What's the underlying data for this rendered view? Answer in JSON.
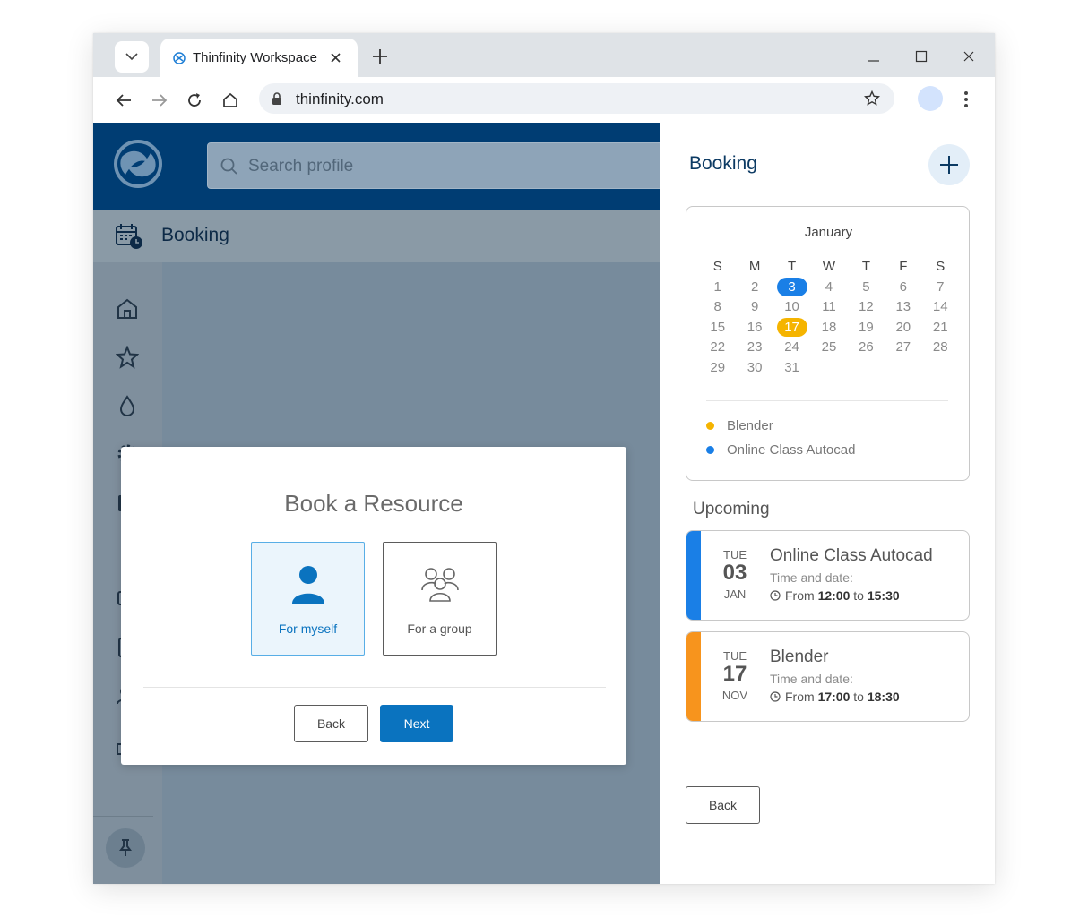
{
  "browser": {
    "tab_title": "Thinfinity Workspace",
    "url": "thinfinity.com"
  },
  "app": {
    "search_placeholder": "Search profile",
    "section_title": "Booking",
    "sidebar_icons": [
      "home-icon",
      "star-icon",
      "drop-icon",
      "gear-icon",
      "calendar-icon",
      "device-icon",
      "monitor-icon",
      "window-icon",
      "users-icon",
      "bar-chart-icon",
      "pin-icon"
    ]
  },
  "dialog": {
    "title": "Book a Resource",
    "option_myself": "For myself",
    "option_group": "For a group",
    "back_label": "Back",
    "next_label": "Next",
    "selected_option": "For myself"
  },
  "panel": {
    "title": "Booking",
    "calendar": {
      "month": "January",
      "weekdays": [
        "S",
        "M",
        "T",
        "W",
        "T",
        "F",
        "S"
      ],
      "weeks": [
        [
          "1",
          "2",
          "3",
          "4",
          "5",
          "6",
          "7"
        ],
        [
          "8",
          "9",
          "10",
          "11",
          "12",
          "13",
          "14"
        ],
        [
          "15",
          "16",
          "17",
          "18",
          "19",
          "20",
          "21"
        ],
        [
          "22",
          "23",
          "24",
          "25",
          "26",
          "27",
          "28"
        ],
        [
          "29",
          "30",
          "31",
          "",
          "",
          "",
          ""
        ]
      ],
      "highlights": {
        "3": "#1a7fe6",
        "17": "#f5b400"
      }
    },
    "legend": [
      {
        "label": "Blender",
        "color": "#f5b400"
      },
      {
        "label": "Online Class Autocad",
        "color": "#1a7fe6"
      }
    ],
    "upcoming_title": "Upcoming",
    "events": [
      {
        "dow": "TUE",
        "day": "03",
        "month": "JAN",
        "title": "Online Class Autocad",
        "subtitle": "Time and date:",
        "from_word": "From",
        "start": "12:00",
        "to_word": "to",
        "end": "15:30",
        "color": "#1a7fe6"
      },
      {
        "dow": "TUE",
        "day": "17",
        "month": "NOV",
        "title": "Blender",
        "subtitle": "Time and date:",
        "from_word": "From",
        "start": "17:00",
        "to_word": "to",
        "end": "18:30",
        "color": "#f7941d"
      }
    ],
    "back_label": "Back"
  }
}
